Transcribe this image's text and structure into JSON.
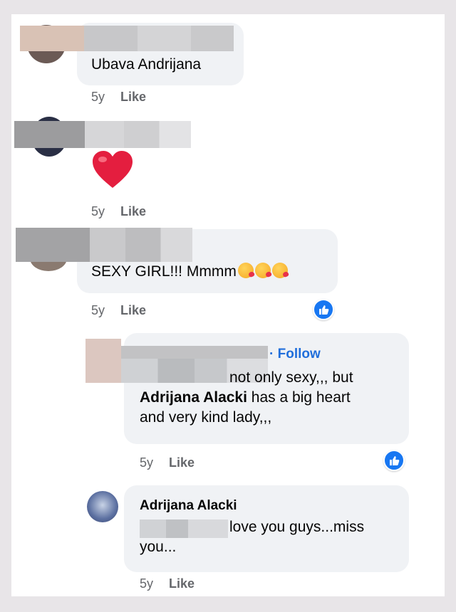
{
  "comments": [
    {
      "text": "Ubava Andrijana",
      "time": "5y",
      "like_label": "Like"
    },
    {
      "emoji": "heart-emoji",
      "time": "5y",
      "like_label": "Like"
    },
    {
      "text": "SEXY GIRL!!! Mmmm",
      "emojis": [
        "kissing-heart-emoji",
        "kissing-heart-emoji",
        "kissing-heart-emoji"
      ],
      "time": "5y",
      "like_label": "Like",
      "reaction": "like-reaction-icon"
    }
  ],
  "replies": [
    {
      "follow_label": "· Follow",
      "text_line1": "not only sexy,,, but",
      "mention": "Adrijana Alacki",
      "text_line2": " has a big heart",
      "text_line3": "and very kind lady,,,",
      "time": "5y",
      "like_label": "Like",
      "reaction": "like-reaction-icon"
    },
    {
      "author": "Adrijana Alacki",
      "text_line1": "love you guys...miss",
      "text_line2": "you...",
      "time": "5y",
      "like_label": "Like"
    }
  ],
  "colors": {
    "bubble": "#f0f2f5",
    "meta": "#65676b",
    "link": "#216fdb",
    "like_blue": "#1877f2",
    "heart": "#e41e3f"
  }
}
